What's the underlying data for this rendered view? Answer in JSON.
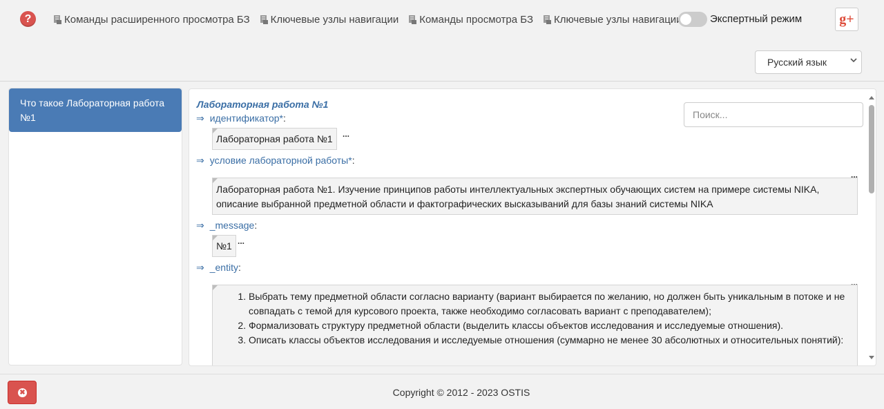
{
  "header": {
    "help_icon": "?",
    "menu": [
      {
        "label": "Команды расширенного просмотра БЗ"
      },
      {
        "label": "Ключевые узлы навигации"
      },
      {
        "label": "Команды просмотра БЗ"
      },
      {
        "label": "Ключевые узлы навигации"
      }
    ],
    "expert_mode_label": "Экспертный режим",
    "expert_mode_on": false,
    "gplus_label": "g+",
    "language": "Русский язык"
  },
  "sidebar": {
    "items": [
      {
        "label": "Что такое Лабораторная работа №1"
      }
    ]
  },
  "main": {
    "search_placeholder": "Поиск...",
    "title": "Лабораторная работа №1",
    "arrow": "⇒",
    "dots": "...",
    "colon": ":",
    "relations": [
      {
        "label": "идентификатор*",
        "value": "Лабораторная работа №1"
      },
      {
        "label": "условие лабораторной работы*",
        "value": "Лабораторная работа №1. Изучение принципов работы интеллектуальных экспертных обучающих систем на примере системы NIKA, описание выбранной предметной области и фактографических высказываний для базы знаний системы NIKA"
      },
      {
        "label": "_message",
        "value": "№1"
      },
      {
        "label": "_entity",
        "items": [
          "Выбрать тему предметной области согласно варианту (вариант выбирается по желанию, но должен быть уникальным в потоке и не совпадать с темой для курсового проекта, также необходимо согласовать вариант с преподавателем);",
          "Формализовать структуру предметной области (выделить классы объектов исследования и исследуемые отношения).",
          "Описать классы объектов исследования и исследуемые отношения (суммарно не менее 30 абсолютных и относительных понятий):"
        ]
      }
    ]
  },
  "footer": {
    "close_icon": "✖",
    "copyright": "Copyright © 2012 - 2023 OSTIS"
  },
  "colors": {
    "accent": "#4a7bb5",
    "link": "#3a6ea5",
    "danger": "#d9534f"
  }
}
